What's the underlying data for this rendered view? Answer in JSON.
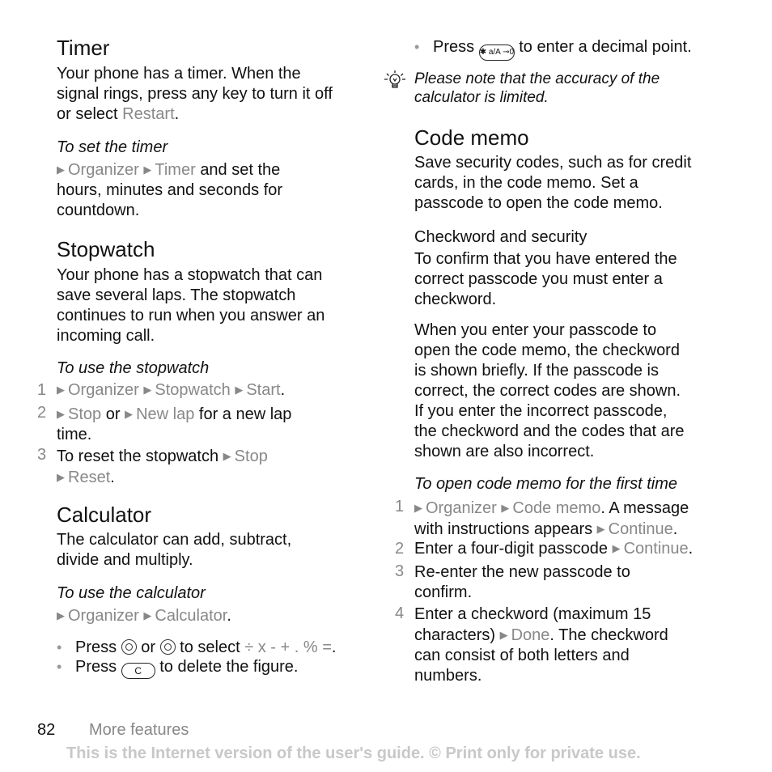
{
  "page": {
    "number": "82",
    "section": "More features",
    "notice": "This is the Internet version of the user's guide. © Print only for private use."
  },
  "timer": {
    "title": "Timer",
    "intro_1": "Your phone has a timer. When the",
    "intro_2": "signal rings, press any key to turn it off",
    "intro_3": "or select",
    "restart": "Restart",
    "sub_title": "To set the timer",
    "nav_organizer": "Organizer",
    "nav_timer": "Timer",
    "set_1": "and set the",
    "set_2": "hours, minutes and seconds for",
    "set_3": "countdown."
  },
  "stopwatch": {
    "title": "Stopwatch",
    "intro_1": "Your phone has a stopwatch that can",
    "intro_2": "save several laps. The stopwatch",
    "intro_3": "continues to run when you answer an",
    "intro_4": "incoming call.",
    "sub_title": "To use the stopwatch",
    "steps": [
      {
        "num": "1",
        "organizer": "Organizer",
        "stopwatch": "Stopwatch",
        "start": "Start"
      },
      {
        "num": "2",
        "stop": "Stop",
        "or": "or",
        "new_lap": "New lap",
        "rest_1": "for a new lap",
        "rest_2": "time."
      },
      {
        "num": "3",
        "text": "To reset the stopwatch",
        "stop": "Stop",
        "reset": "Reset"
      }
    ]
  },
  "calculator": {
    "title": "Calculator",
    "intro_1": "The calculator can add, subtract,",
    "intro_2": "divide and multiply.",
    "sub_title": "To use the calculator",
    "nav_organizer": "Organizer",
    "nav_calculator": "Calculator",
    "bullets": {
      "press": "Press",
      "or": "or",
      "to_select": "to select",
      "operators": "÷ x - + . % =",
      "delete_text": "to delete the figure.",
      "c_key": "C",
      "decimal_text": "to enter a decimal point.",
      "star_key": "✱ a/A ⊸0"
    },
    "tip": "Please note that the accuracy of the",
    "tip_2": "calculator is limited."
  },
  "code_memo": {
    "title": "Code memo",
    "intro_1": "Save security codes, such as for credit",
    "intro_2": "cards, in the code memo. Set a",
    "intro_3": "passcode to open the code memo.",
    "checkword_title": "Checkword and security",
    "cw_1": "To confirm that you have entered the",
    "cw_2": "correct passcode you must enter a",
    "cw_3": "checkword.",
    "p2_1": "When you enter your passcode to",
    "p2_2": "open the code memo, the checkword",
    "p2_3": "is shown briefly. If the passcode is",
    "p2_4": "correct, the correct codes are shown.",
    "p2_5": "If you enter the incorrect passcode,",
    "p2_6": "the checkword and the codes that are",
    "p2_7": "shown are also incorrect.",
    "sub_title": "To open code memo for the first time",
    "steps": [
      {
        "num": "1",
        "organizer": "Organizer",
        "code_memo": "Code memo",
        "rest": ". A message",
        "line2": "with instructions appears",
        "continue": "Continue"
      },
      {
        "num": "2",
        "text": "Enter a four-digit passcode",
        "continue": "Continue"
      },
      {
        "num": "3",
        "line1": "Re-enter the new passcode to",
        "line2": "confirm."
      },
      {
        "num": "4",
        "line1": "Enter a checkword (maximum 15",
        "line2a": "characters)",
        "done": "Done",
        "line2b": ". The checkword",
        "line3": "can consist of both letters and",
        "line4": "numbers."
      }
    ]
  }
}
